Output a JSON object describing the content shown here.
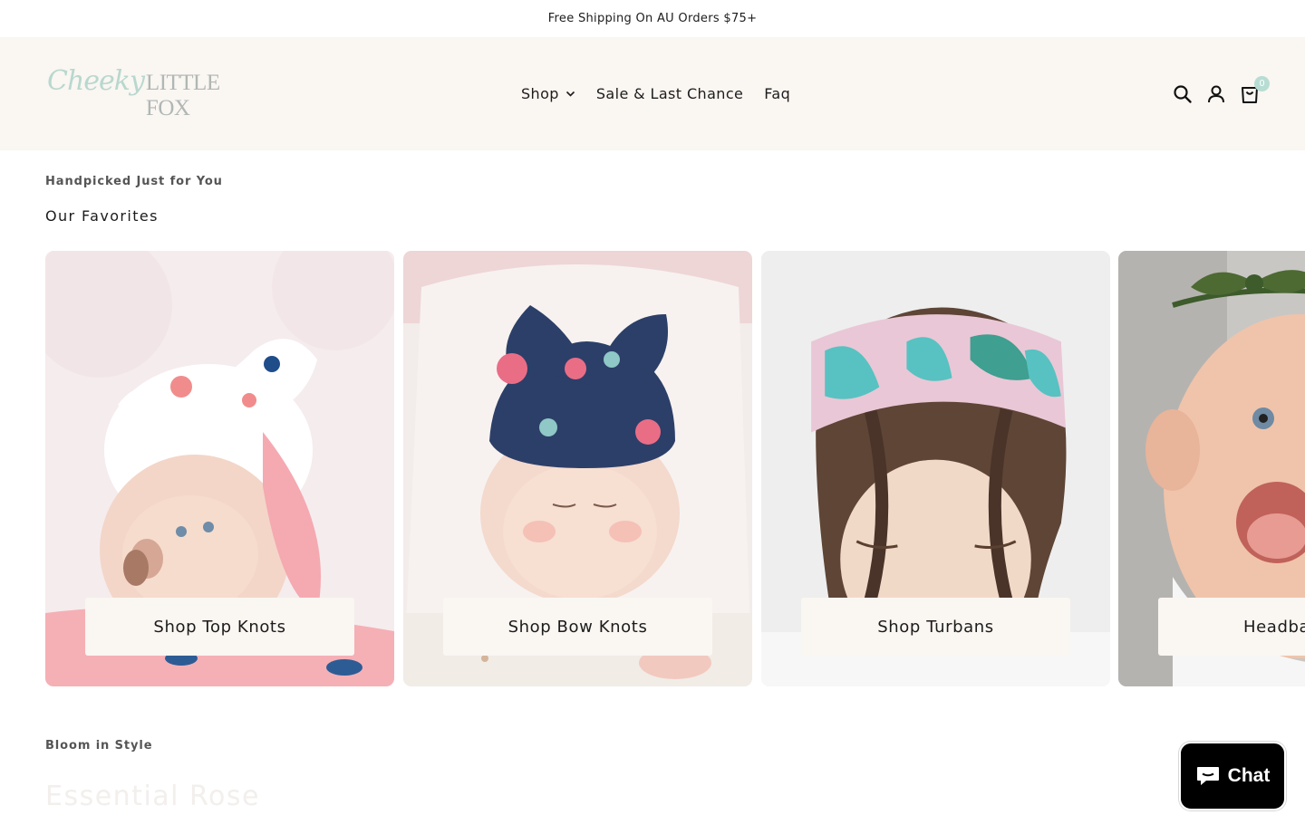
{
  "announcement": {
    "text": "Free Shipping On AU Orders $75+"
  },
  "logo": {
    "part1": "Cheeky",
    "part2": "LITTLE FOX"
  },
  "nav": {
    "items": [
      {
        "label": "Shop",
        "has_dropdown": true
      },
      {
        "label": "Sale & Last Chance",
        "has_dropdown": false
      },
      {
        "label": "Faq",
        "has_dropdown": false
      }
    ]
  },
  "header_icons": {
    "search_icon": "search-icon",
    "account_icon": "user-icon",
    "cart_icon": "shopping-bag-icon",
    "cart_count": "0"
  },
  "favorites": {
    "subtitle": "Handpicked Just for You",
    "title": "Our Favorites",
    "cards": [
      {
        "label": "Shop Top Knots",
        "image": "baby-wearing-floral-top-knot-headband"
      },
      {
        "label": "Shop Bow Knots",
        "image": "baby-wearing-navy-floral-bow-knot"
      },
      {
        "label": "Shop Turbans",
        "image": "toddler-wearing-tropical-leaf-turban"
      },
      {
        "label": "Headba",
        "image": "baby-wearing-green-bow-headband"
      }
    ]
  },
  "bloom": {
    "subtitle": "Bloom in Style",
    "title": "Essential Rose"
  },
  "chat": {
    "label": "Chat",
    "icon": "chat-bubble-icon"
  },
  "colors": {
    "header_bg": "#faf6f2",
    "accent_mint": "#b7ddd3",
    "chat_bg": "#000000"
  }
}
